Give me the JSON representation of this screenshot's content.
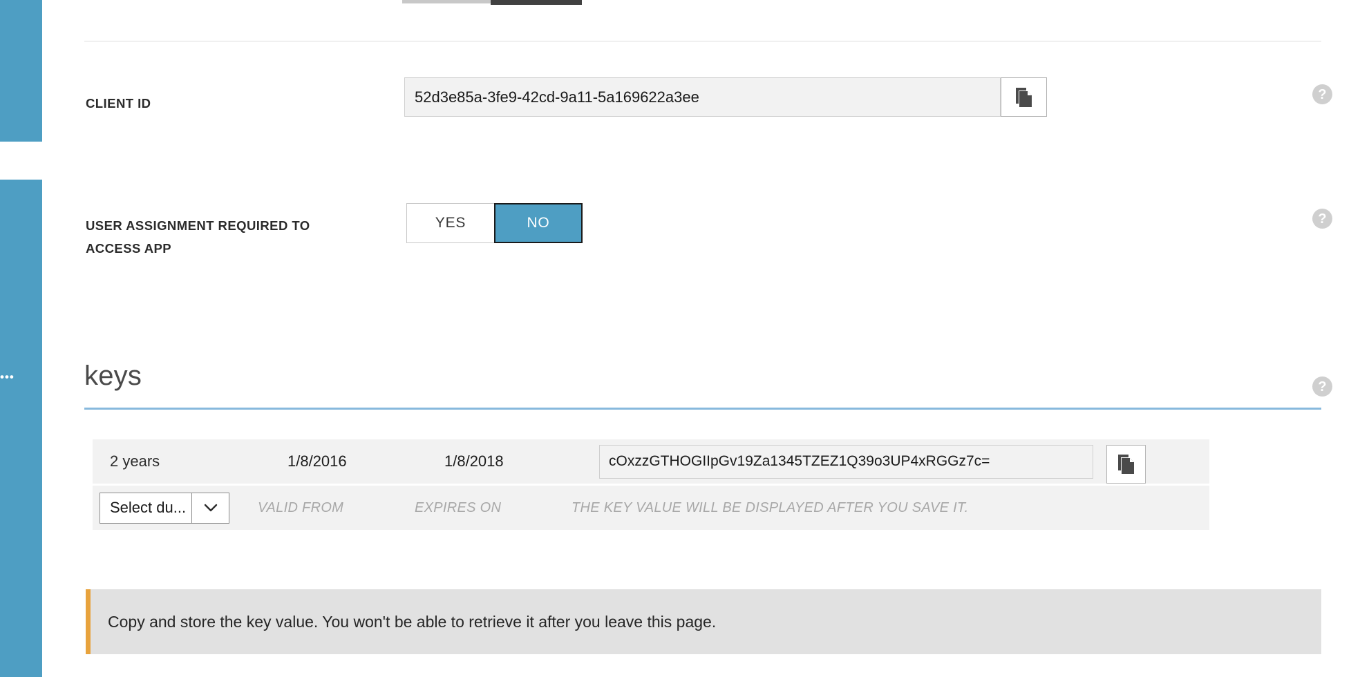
{
  "sidebar": {
    "ellipsis": "•••"
  },
  "fields": {
    "client_id": {
      "label": "CLIENT ID",
      "value": "52d3e85a-3fe9-42cd-9a11-5a169622a3ee",
      "copy_icon": "copy-icon",
      "help_icon": "help-icon"
    },
    "user_assignment": {
      "label": "USER ASSIGNMENT REQUIRED TO ACCESS APP",
      "option_yes": "YES",
      "option_no": "NO",
      "selected": "NO",
      "help_icon": "help-icon"
    }
  },
  "keys_section": {
    "heading": "keys",
    "help_icon": "help-icon",
    "accent_color": "#87b9dd",
    "rows": [
      {
        "duration": "2 years",
        "valid_from": "1/8/2016",
        "expires_on": "1/8/2018",
        "key_value": "cOxzzGTHOGIIpGv19Za1345TZEZ1Q39o3UP4xRGGz7c=",
        "copy_icon": "copy-icon"
      },
      {
        "duration_placeholder": "Select du...",
        "chevron_icon": "chevron-down-icon",
        "valid_from_placeholder": "VALID FROM",
        "expires_on_placeholder": "EXPIRES ON",
        "key_value_placeholder": "THE KEY VALUE WILL BE DISPLAYED AFTER YOU SAVE IT."
      }
    ]
  },
  "warning": {
    "message": "Copy and store the key value. You won't be able to retrieve it after you leave this page.",
    "accent_color": "#e8a33d"
  },
  "colors": {
    "rail_blue": "#4e9ec3",
    "toggle_selected": "#4e9ec3",
    "row_background": "#f2f2f2"
  }
}
